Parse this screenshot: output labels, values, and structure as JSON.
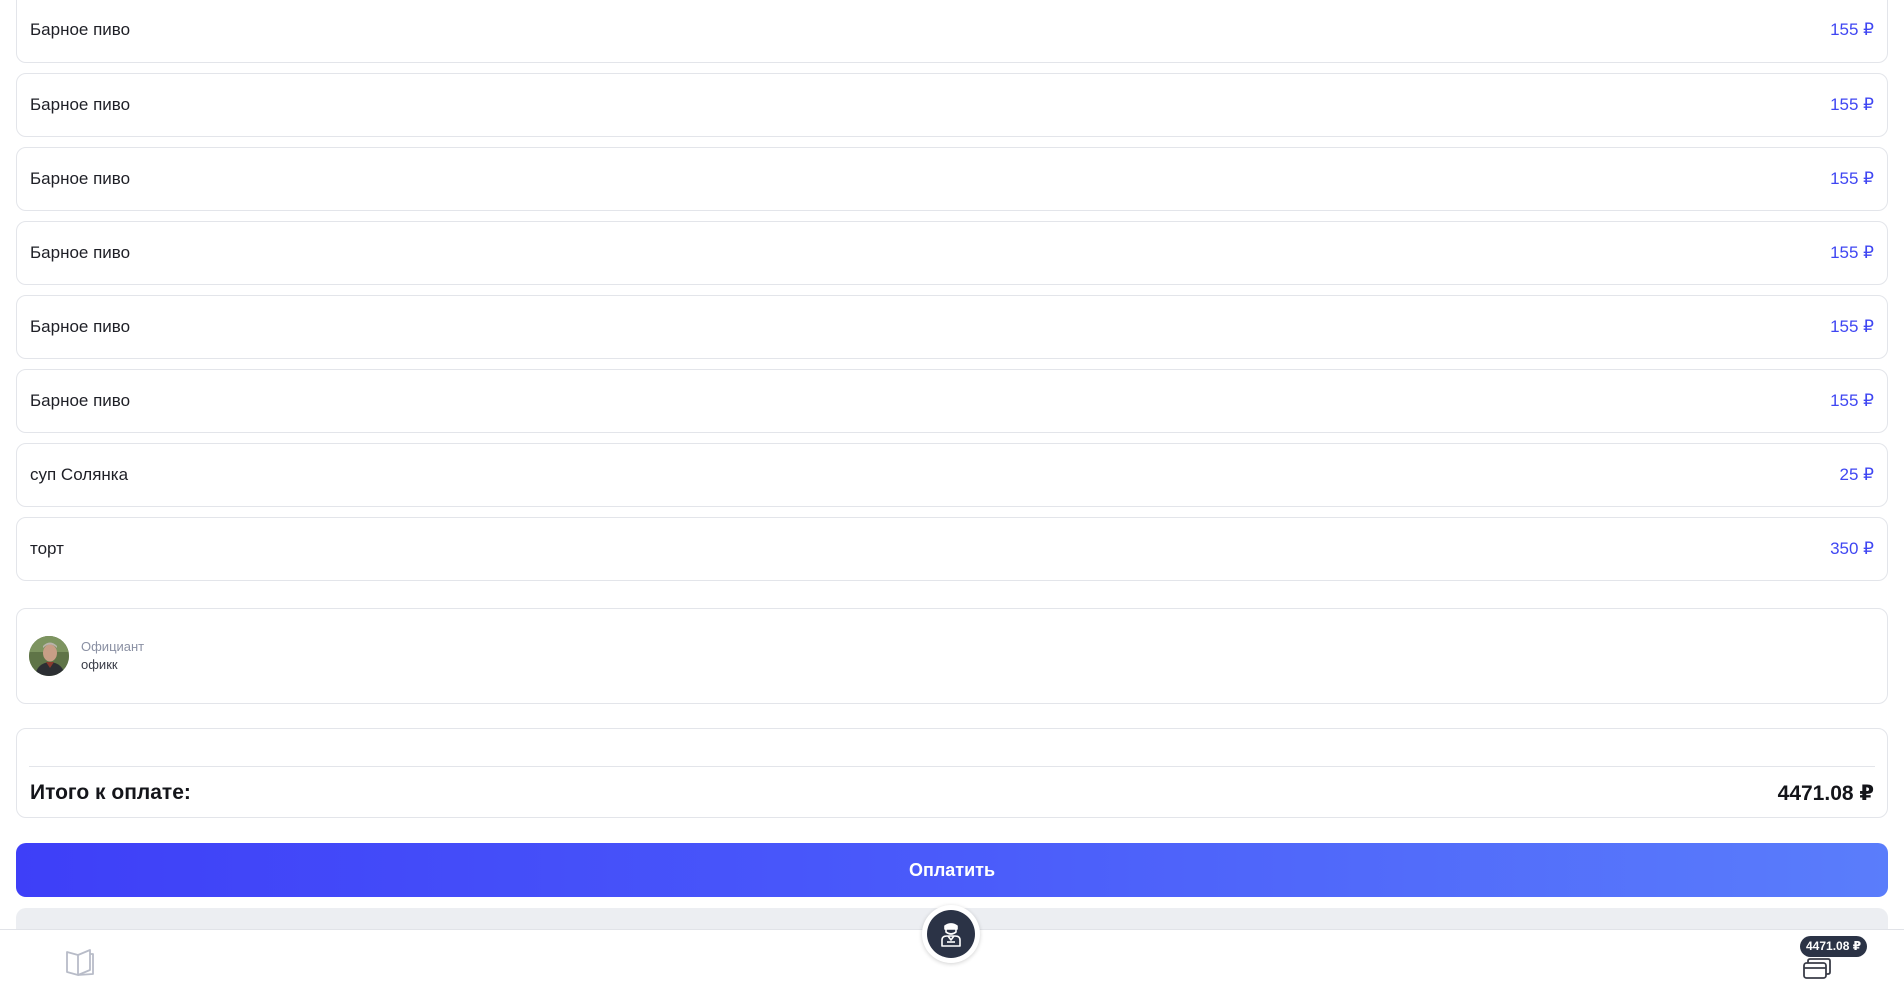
{
  "order_items": [
    {
      "name": "Барное пиво",
      "price": "155 ₽"
    },
    {
      "name": "Барное пиво",
      "price": "155 ₽"
    },
    {
      "name": "Барное пиво",
      "price": "155 ₽"
    },
    {
      "name": "Барное пиво",
      "price": "155 ₽"
    },
    {
      "name": "Барное пиво",
      "price": "155 ₽"
    },
    {
      "name": "Барное пиво",
      "price": "155 ₽"
    },
    {
      "name": "суп Солянка",
      "price": "25 ₽"
    },
    {
      "name": "торт",
      "price": "350 ₽"
    }
  ],
  "waiter": {
    "role": "Официант",
    "name": "офикк"
  },
  "total": {
    "label": "Итого к оплате:",
    "value": "4471.08 ₽"
  },
  "pay_button": {
    "label": "Оплатить"
  },
  "bottom_nav": {
    "menu_icon": "book-icon",
    "call_icon": "waiter-icon",
    "cart_badge": "4471.08 ₽",
    "cart_icon": "card-icon"
  },
  "colors": {
    "accent": "#3f46f2",
    "button_gradient_start": "#3e3ff8",
    "button_gradient_end": "#5a7dfb",
    "dark": "#2b3346"
  }
}
